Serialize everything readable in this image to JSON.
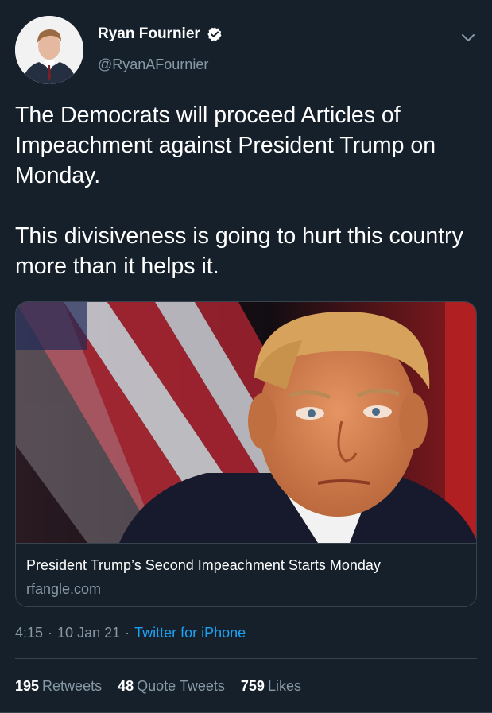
{
  "author": {
    "display_name": "Ryan Fournier",
    "handle": "@RyanAFournier",
    "verified": true
  },
  "tweet": {
    "paragraphs": [
      "The Democrats will proceed Articles of Impeachment against President Trump on Monday.",
      "This divisiveness is going to hurt this country more than it helps it."
    ]
  },
  "card": {
    "title": "President Trump’s Second Impeachment Starts Monday",
    "domain": "rfangle.com"
  },
  "meta": {
    "time": "4:15",
    "separator": "·",
    "date": "10 Jan 21",
    "source": "Twitter for iPhone"
  },
  "stats": {
    "retweets_count": "195",
    "retweets_label": "Retweets",
    "quotes_count": "48",
    "quotes_label": "Quote Tweets",
    "likes_count": "759",
    "likes_label": "Likes"
  },
  "colors": {
    "background": "#15202b",
    "text_primary": "#ffffff",
    "text_secondary": "#8899a6",
    "accent": "#1da1f2",
    "border": "#38444d"
  }
}
